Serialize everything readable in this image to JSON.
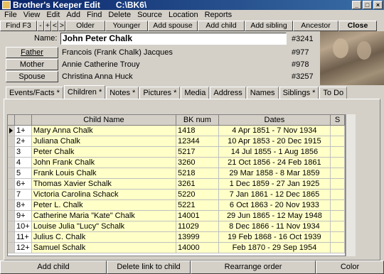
{
  "window": {
    "title": "Brother's Keeper Edit",
    "path": "C:\\BK6\\"
  },
  "menu": [
    "File",
    "View",
    "Edit",
    "Add",
    "Find",
    "Delete",
    "Source",
    "Location",
    "Reports"
  ],
  "toolbar": {
    "find": "Find  F3",
    "minus": "-",
    "plus": "+",
    "prev": "<",
    "next": ">",
    "older": "Older",
    "younger": "Younger",
    "add_spouse": "Add spouse",
    "add_child": "Add child",
    "add_sibling": "Add sibling",
    "ancestor": "Ancestor",
    "close": "Close"
  },
  "person": {
    "name_label": "Name:",
    "name": "John Peter Chalk",
    "record": "#3241",
    "father_label": "Father",
    "father": "Francois (Frank Chalk) Jacques",
    "father_record": "#977",
    "mother_label": "Mother",
    "mother": "Annie Catherine Trouy",
    "mother_record": "#978",
    "spouse_label": "Spouse",
    "spouse": "Christina Anna Huck",
    "spouse_record": "#3257"
  },
  "tabs": [
    "Events/Facts *",
    "Children *",
    "Notes *",
    "Pictures *",
    "Media",
    "Address",
    "Names",
    "Siblings *",
    "To Do"
  ],
  "table": {
    "headers": [
      "",
      "Child Name",
      "BK num",
      "Dates",
      "S"
    ],
    "rows": [
      {
        "n": "1+",
        "name": "Mary Anna Chalk",
        "bk": "1418",
        "dates": "4 Apr 1851  -  7 Nov 1934",
        "s": ""
      },
      {
        "n": "2+",
        "name": "Juliana Chalk",
        "bk": "12344",
        "dates": "10 Apr 1853  -  20 Dec 1915",
        "s": ""
      },
      {
        "n": "3",
        "name": "Peter Chalk",
        "bk": "5217",
        "dates": "14 Jul 1855  -  1 Aug 1856",
        "s": ""
      },
      {
        "n": "4",
        "name": "John Frank Chalk",
        "bk": "3260",
        "dates": "21 Oct 1856  -  24 Feb 1861",
        "s": ""
      },
      {
        "n": "5",
        "name": "Frank Louis Chalk",
        "bk": "5218",
        "dates": "29 Mar 1858  -  8 Mar 1859",
        "s": ""
      },
      {
        "n": "6+",
        "name": "Thomas Xavier Schalk",
        "bk": "3261",
        "dates": "1 Dec 1859  -  27 Jan 1925",
        "s": ""
      },
      {
        "n": "7",
        "name": "Victoria Carolina Schack",
        "bk": "5220",
        "dates": "7 Jan 1861  -  12 Dec 1865",
        "s": ""
      },
      {
        "n": "8+",
        "name": "Peter L. Chalk",
        "bk": "5221",
        "dates": "6 Oct 1863  -  20 Nov 1933",
        "s": ""
      },
      {
        "n": "9+",
        "name": "Catherine Maria \"Kate\" Chalk",
        "bk": "14001",
        "dates": "29 Jun 1865  -  12 May 1948",
        "s": ""
      },
      {
        "n": "10+",
        "name": "Louise Julia \"Lucy\" Schalk",
        "bk": "11029",
        "dates": "8 Dec 1866  -  11 Nov 1934",
        "s": ""
      },
      {
        "n": "11+",
        "name": "Julius C. Chalk",
        "bk": "13999",
        "dates": "19 Feb 1868  -  16 Oct 1939",
        "s": ""
      },
      {
        "n": "12+",
        "name": "Samuel Schalk",
        "bk": "14000",
        "dates": "Feb 1870  -  29 Sep 1954",
        "s": ""
      }
    ]
  },
  "bottom": {
    "add_child": "Add child",
    "delete_link": "Delete link to child",
    "rearrange": "Rearrange order",
    "color": "Color"
  }
}
